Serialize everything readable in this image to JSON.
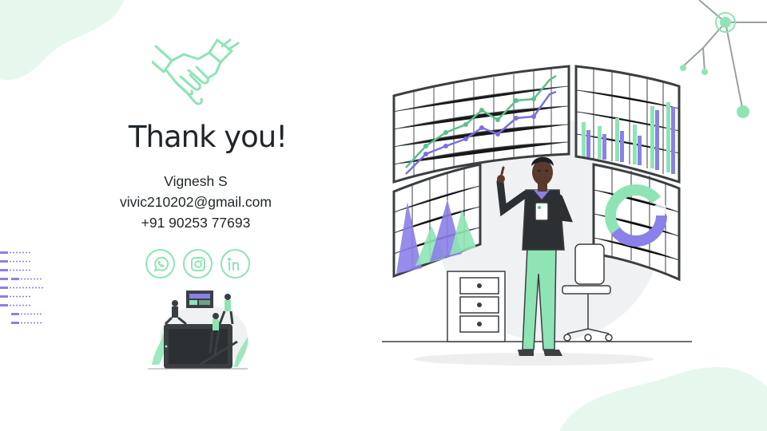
{
  "title": "Thank you!",
  "contact": {
    "name": "Vignesh S",
    "email": "vivic210202@gmail.com",
    "phone": "+91 90253 77693"
  },
  "social": [
    {
      "icon": "whatsapp-icon"
    },
    {
      "icon": "instagram-icon"
    },
    {
      "icon": "linkedin-icon"
    }
  ],
  "colors": {
    "mint": "#8ee4b4",
    "mint_light": "#e6f8ee",
    "purple": "#8b80e8",
    "text": "#1f2529",
    "line": "#3b3f42"
  }
}
